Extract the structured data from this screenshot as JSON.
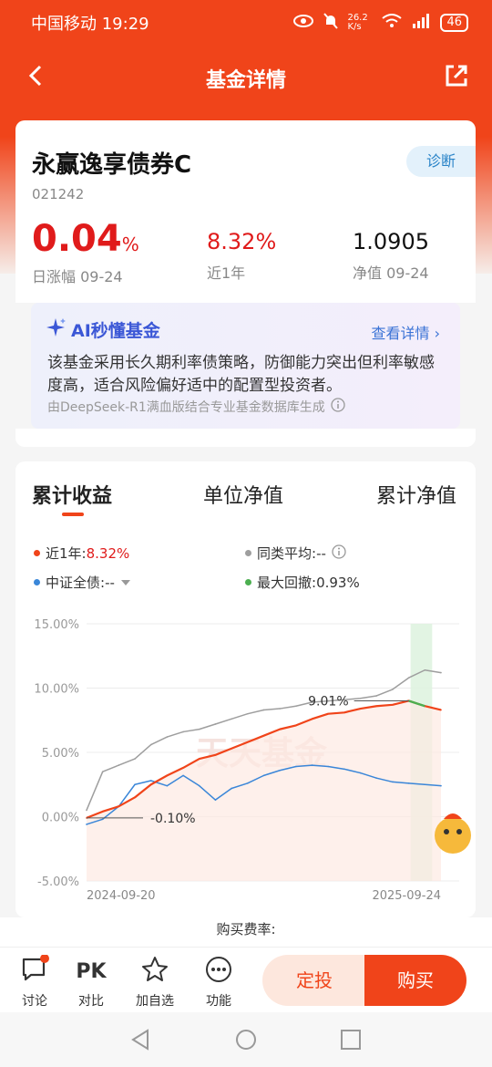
{
  "status": {
    "carrier": "中国移动 19:29",
    "speed": "26.2 K/s",
    "battery": "46"
  },
  "nav": {
    "title": "基金详情",
    "back_icon": "back-arrow-icon",
    "share_icon": "share-icon"
  },
  "fund": {
    "name": "永赢逸享债券C",
    "code": "021242",
    "diagnose_label": "诊断",
    "daily_change": "0.04",
    "daily_change_unit": "%",
    "daily_change_label": "日涨幅 09-24",
    "year_return": "8.32%",
    "year_return_label": "近1年",
    "nav_value": "1.0905",
    "nav_label": "净值 09-24"
  },
  "ai": {
    "title": "AI秒懂基金",
    "more": "查看详情 ›",
    "body": "该基金采用长久期利率债策略，防御能力突出但利率敏感度高，适合风险偏好适中的配置型投资者。",
    "source": "由DeepSeek-R1满血版结合专业基金数据库生成"
  },
  "chart_tabs": [
    "累计收益",
    "单位净值",
    "累计净值"
  ],
  "legend": {
    "fund_label": "近1年:",
    "fund_value": "8.32%",
    "peer_label": "同类平均:",
    "peer_value": "--",
    "index_label": "中证全债:",
    "index_value": "--",
    "drawdown_label": "最大回撤:",
    "drawdown_value": "0.93%"
  },
  "chart_data": {
    "type": "line",
    "ytick_labels": [
      "15.00%",
      "10.00%",
      "5.00%",
      "0.00%",
      "-5.00%"
    ],
    "ylim": [
      -5,
      15
    ],
    "xtick_labels": [
      "2024-09-20",
      "2025-09-24"
    ],
    "annotations": [
      {
        "text": "9.01%",
        "kind": "max"
      },
      {
        "text": "-0.10%",
        "kind": "min"
      }
    ],
    "watermark": "天天基金",
    "series": [
      {
        "name": "近1年",
        "color": "#f0441a",
        "values": [
          -0.1,
          0.4,
          0.8,
          1.5,
          2.5,
          3.2,
          3.8,
          4.5,
          4.8,
          5.3,
          5.8,
          6.3,
          6.8,
          7.1,
          7.6,
          8.0,
          8.1,
          8.4,
          8.6,
          8.7,
          9.01,
          8.6,
          8.3
        ]
      },
      {
        "name": "同类平均",
        "color": "#9e9e9e",
        "values": [
          0.5,
          3.5,
          4.0,
          4.5,
          5.6,
          6.2,
          6.6,
          6.8,
          7.2,
          7.6,
          8.0,
          8.3,
          8.4,
          8.6,
          8.9,
          9.0,
          9.1,
          9.2,
          9.4,
          9.9,
          10.8,
          11.4,
          11.2
        ]
      },
      {
        "name": "中证全债",
        "color": "#3a86d8",
        "values": [
          -0.6,
          -0.2,
          0.8,
          2.5,
          2.8,
          2.4,
          3.2,
          2.4,
          1.3,
          2.2,
          2.6,
          3.2,
          3.6,
          3.9,
          4.0,
          3.9,
          3.7,
          3.4,
          3.0,
          2.7,
          2.6,
          2.5,
          2.4
        ]
      }
    ]
  },
  "fee_text": "购买费率:",
  "bottom": {
    "discuss": "讨论",
    "pk": "PK",
    "compare": "对比",
    "watch": "加自选",
    "func": "功能",
    "dingtou": "定投",
    "buy": "购买"
  }
}
